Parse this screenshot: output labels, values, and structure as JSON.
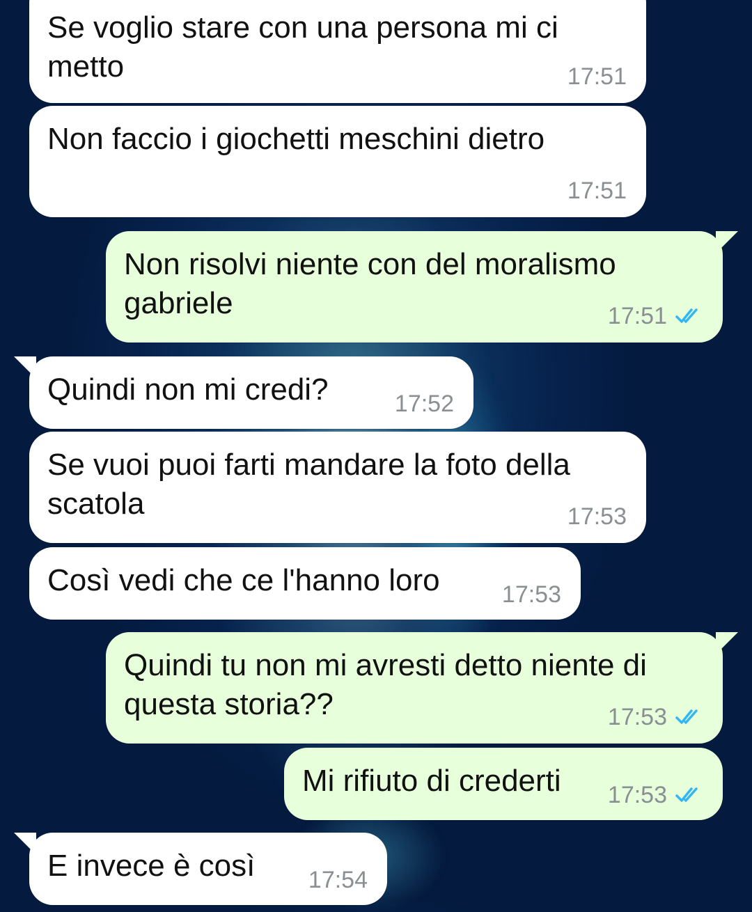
{
  "chat": {
    "messages": [
      {
        "direction": "in",
        "text": "Se voglio stare con una persona mi ci\nmetto",
        "time": "17:51"
      },
      {
        "direction": "in",
        "text": "Non faccio i giochetti meschini dietro",
        "time": "17:51"
      },
      {
        "direction": "out",
        "text": "Non risolvi niente con del moralismo\ngabriele",
        "time": "17:51",
        "status": "read"
      },
      {
        "direction": "in",
        "text": "Quindi non mi credi?",
        "time": "17:52"
      },
      {
        "direction": "in",
        "text": "Se vuoi puoi farti mandare la foto della\nscatola",
        "time": "17:53"
      },
      {
        "direction": "in",
        "text": "Così vedi che ce l'hanno loro",
        "time": "17:53"
      },
      {
        "direction": "out",
        "text": "Quindi tu non mi avresti detto niente di\nquesta storia??",
        "time": "17:53",
        "status": "read"
      },
      {
        "direction": "out",
        "text": "Mi rifiuto di crederti",
        "time": "17:53",
        "status": "read"
      },
      {
        "direction": "in",
        "text": "E invece è così",
        "time": "17:54"
      }
    ]
  },
  "colors": {
    "incoming_bubble": "#ffffff",
    "outgoing_bubble": "#e7ffdb",
    "read_tick": "#34b7f1",
    "timestamp": "#8a8f93"
  },
  "icons": {
    "read_receipt": "double-check-icon"
  }
}
